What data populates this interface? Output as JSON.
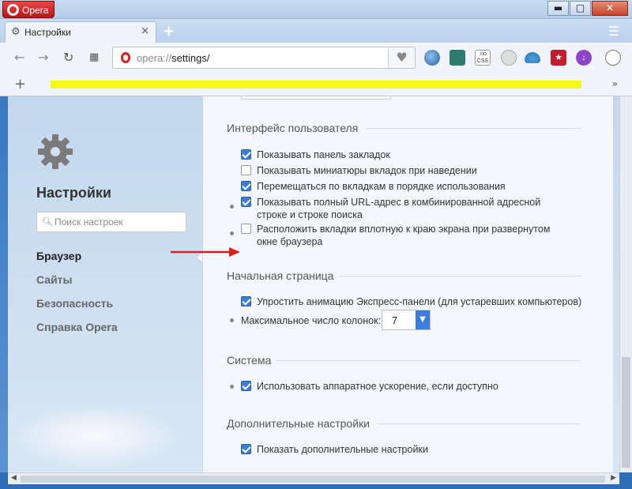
{
  "window": {
    "app_button": "Opera",
    "min": "▬",
    "max": "□",
    "close": "✕"
  },
  "tab": {
    "title": "Настройки",
    "close": "×"
  },
  "toolbar": {
    "url_scheme": "opera://",
    "url_path": "settings/"
  },
  "sidebar": {
    "title": "Настройки",
    "search_placeholder": "Поиск настроек",
    "items": [
      {
        "label": "Браузер",
        "active": true
      },
      {
        "label": "Сайты",
        "active": false
      },
      {
        "label": "Безопасность",
        "active": false
      },
      {
        "label": "Справка Opera",
        "active": false
      }
    ]
  },
  "sections": {
    "ui": {
      "title": "Интерфейс пользователя",
      "options": [
        {
          "label": "Показывать панель закладок",
          "checked": true
        },
        {
          "label": "Показывать миниатюры вкладок при наведении",
          "checked": false
        },
        {
          "label": "Перемещаться по вкладкам в порядке использования",
          "checked": true
        },
        {
          "label": "Показывать полный URL-адрес в комбинированной адресной строке и строке поиска",
          "checked": true
        },
        {
          "label": "Расположить вкладки вплотную к краю экрана при развернутом окне браузера",
          "checked": false
        }
      ]
    },
    "start": {
      "title": "Начальная страница",
      "options": [
        {
          "label": "Упростить анимацию Экспресс-панели (для устаревших компьютеров)",
          "checked": true
        }
      ],
      "columns_label": "Максимальное число колонок:",
      "columns_value": "7"
    },
    "system": {
      "title": "Система",
      "options": [
        {
          "label": "Использовать аппаратное ускорение, если доступно",
          "checked": true
        }
      ]
    },
    "advanced": {
      "title": "Дополнительные настройки",
      "options": [
        {
          "label": "Показать дополнительные настройки",
          "checked": true
        }
      ]
    }
  },
  "colors": {
    "accent": "#3c7dd8",
    "opera_red": "#e01b1b",
    "arrow": "#e01b1b",
    "highlight": "#f7f700"
  }
}
